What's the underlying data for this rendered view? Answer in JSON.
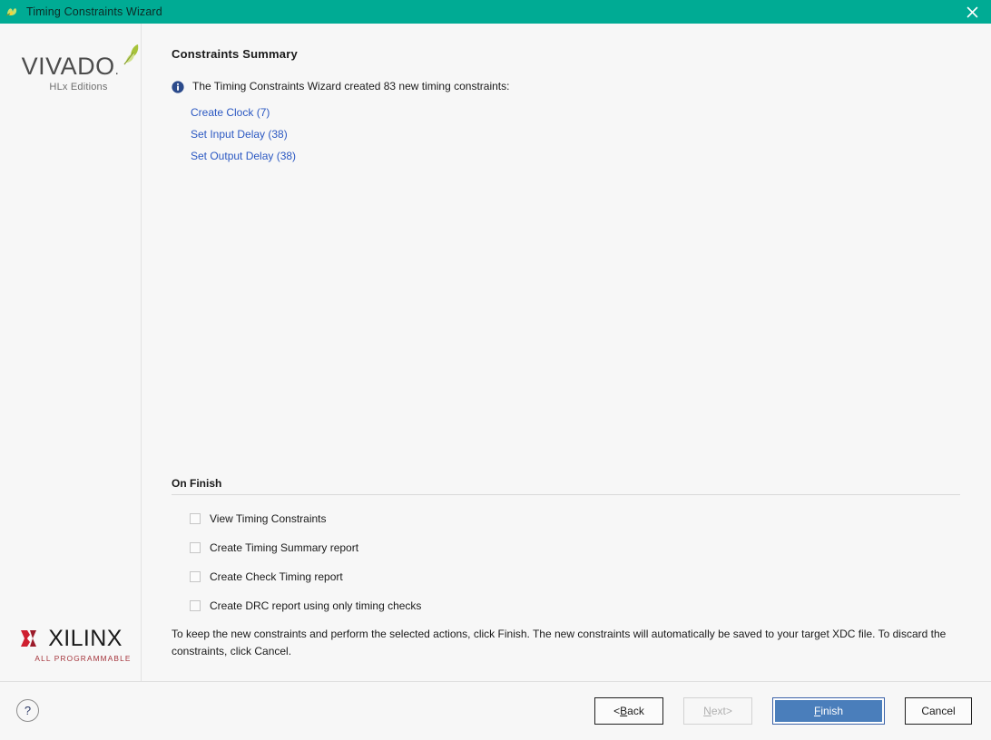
{
  "window": {
    "title": "Timing Constraints Wizard",
    "icon": "vivado-butterfly-icon",
    "close_icon": "close-icon",
    "titlebar_color": "#00ab94"
  },
  "sidebar": {
    "vivado_logo": {
      "wordmark": "VIVADO",
      "dot": ".",
      "subtitle": "HLx Editions",
      "leaf_icon": "leaf-icon"
    },
    "xilinx_logo": {
      "mark_icon": "xilinx-x-icon",
      "wordmark": "XILINX",
      "tagline": "ALL PROGRAMMABLE"
    }
  },
  "main": {
    "page_title": "Constraints Summary",
    "info_icon": "info-icon",
    "summary_text": "The Timing Constraints Wizard created 83 new timing constraints:",
    "links": [
      {
        "label": "Create Clock (7)"
      },
      {
        "label": "Set Input Delay (38)"
      },
      {
        "label": "Set Output Delay (38)"
      }
    ],
    "on_finish": {
      "group_label": "On Finish",
      "options": [
        {
          "label": "View Timing Constraints",
          "checked": false
        },
        {
          "label": "Create Timing Summary report",
          "checked": false
        },
        {
          "label": "Create Check Timing report",
          "checked": false
        },
        {
          "label": "Create DRC report using only timing checks",
          "checked": false
        }
      ]
    },
    "footer_note": "To keep the new constraints and perform the selected actions, click Finish. The new constraints will automatically be saved to your target XDC file. To discard the constraints, click Cancel."
  },
  "footer": {
    "help_label": "?",
    "buttons": {
      "back": {
        "prefix": "< ",
        "mnemonic": "B",
        "rest": "ack",
        "enabled": true
      },
      "next": {
        "mnemonic": "N",
        "rest": "ext",
        "suffix": " >",
        "enabled": false
      },
      "finish": {
        "mnemonic": "F",
        "rest": "inish",
        "enabled": true,
        "primary": true,
        "color": "#4a7ebb"
      },
      "cancel": {
        "label": "Cancel",
        "enabled": true
      }
    }
  }
}
